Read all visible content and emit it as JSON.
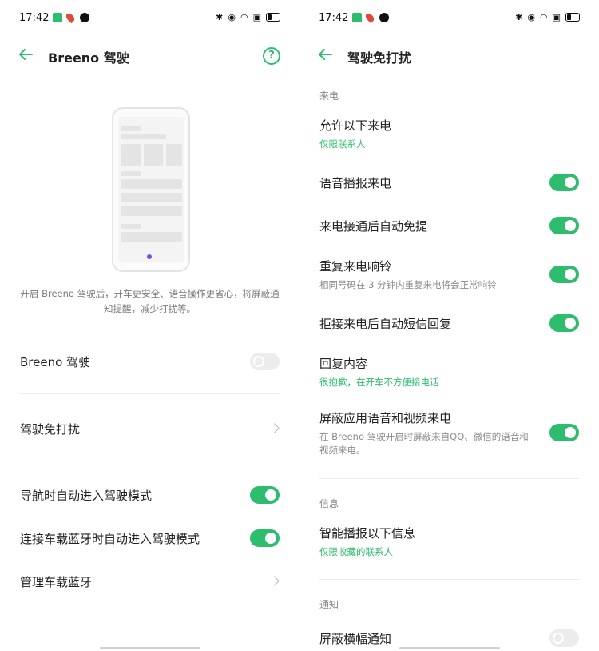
{
  "left": {
    "status": {
      "time": "17:42"
    },
    "title": "Breeno 驾驶",
    "help_glyph": "?",
    "description": "开启 Breeno 驾驶后，开车更安全、语音操作更省心，将屏蔽通知提醒，减少打扰等。",
    "rows": [
      {
        "label": "Breeno 驾驶",
        "toggle": "off"
      },
      {
        "label": "驾驶免打扰"
      },
      {
        "label": "导航时自动进入驾驶模式",
        "toggle": "on"
      },
      {
        "label": "连接车载蓝牙时自动进入驾驶模式",
        "toggle": "on"
      },
      {
        "label": "管理车载蓝牙"
      }
    ]
  },
  "right": {
    "status": {
      "time": "17:42"
    },
    "title": "驾驶免打扰",
    "sections": {
      "calls": "来电",
      "info": "信息",
      "notify": "通知"
    },
    "rows": [
      {
        "label": "允许以下来电",
        "sub": "仅限联系人"
      },
      {
        "label": "语音播报来电",
        "toggle": "on"
      },
      {
        "label": "来电接通后自动免提",
        "toggle": "on"
      },
      {
        "label": "重复来电响铃",
        "sub": "相同号码在 3 分钟内重复来电将会正常响铃",
        "toggle": "on"
      },
      {
        "label": "拒接来电后自动短信回复",
        "toggle": "on"
      },
      {
        "label": "回复内容",
        "sub": "很抱歉，在开车不方便接电话"
      },
      {
        "label": "屏蔽应用语音和视频来电",
        "sub": "在 Breeno 驾驶开启时屏蔽来自QQ、微信的语音和视频来电。",
        "toggle": "on"
      },
      {
        "label": "智能播报以下信息",
        "sub": "仅限收藏的联系人"
      },
      {
        "label": "屏蔽横幅通知",
        "toggle": "off"
      }
    ]
  },
  "colors": {
    "accent": "#2ebd6e"
  }
}
